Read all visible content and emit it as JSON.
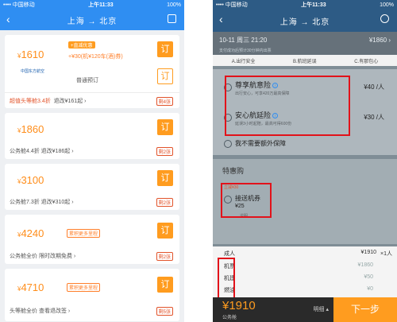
{
  "left": {
    "status": {
      "carrier": "•••• 中国移动",
      "time": "上午11:33",
      "battery": "100%"
    },
    "nav": {
      "route": "上海 → 北京"
    },
    "flights": [
      {
        "price_sym": "¥",
        "price": "1610",
        "airline": "中国东方航空",
        "badge": "+直减优惠",
        "gift": "+¥30(机¥120车(酒)券)",
        "booking": "普通预订",
        "sub_hl": "超值头等舱3.4折",
        "sub": "退改¥161起",
        "remain": "剩4张",
        "order": "订",
        "order2": "订"
      },
      {
        "price_sym": "¥",
        "price": "1860",
        "sub": "公务舱4.4折  退改¥186起",
        "remain": "剩2张",
        "order": "订"
      },
      {
        "price_sym": "¥",
        "price": "3100",
        "sub": "公务舱7.3折  退改¥310起",
        "remain": "剩2张",
        "order": "订"
      },
      {
        "price_sym": "¥",
        "price": "4240",
        "tag": "累积更多里程",
        "sub": "公务舱全价  限时改期免费",
        "remain": "剩2张",
        "order": "订"
      },
      {
        "price_sym": "¥",
        "price": "4710",
        "tag": "累积更多里程",
        "sub": "头等舱全价  查看退改签",
        "remain": "剩5张",
        "order": "订"
      }
    ]
  },
  "right": {
    "status": {
      "carrier": "•••• 中国移动",
      "time": "上午11:33",
      "battery": "100%"
    },
    "nav": {
      "route": "上海 → 北京"
    },
    "flight": {
      "info": "10-11 周三 21:20",
      "price": "¥1860",
      "note": "支付成功后预计30分钟内出票"
    },
    "tabs": [
      "A.出行安全",
      "B.航班延误",
      "C.有那包心"
    ],
    "insurance": [
      {
        "title": "尊享航意险",
        "desc": "出行安心，可享420万最高保障",
        "price": "¥40 /人"
      },
      {
        "title": "安心航延险",
        "desc": "延误3小时起赔，最高可得600份",
        "price": "¥30 /人"
      },
      {
        "title": "我不需要额外保障"
      }
    ],
    "special": {
      "heading": "特惠购",
      "label": "立减¥30",
      "title": "接送机券",
      "price": "¥25",
      "hint": "说明"
    },
    "summary": [
      {
        "label": "成人",
        "value": "¥1910",
        "count": "×1人"
      },
      {
        "label": "机票",
        "value": "¥1860"
      },
      {
        "label": "机建",
        "value": "¥50"
      },
      {
        "label": "燃油",
        "value": "¥0"
      }
    ],
    "bottom": {
      "total": "¥1910",
      "class": "公务舱",
      "detail": "明细 ▴",
      "next": "下一步"
    }
  }
}
